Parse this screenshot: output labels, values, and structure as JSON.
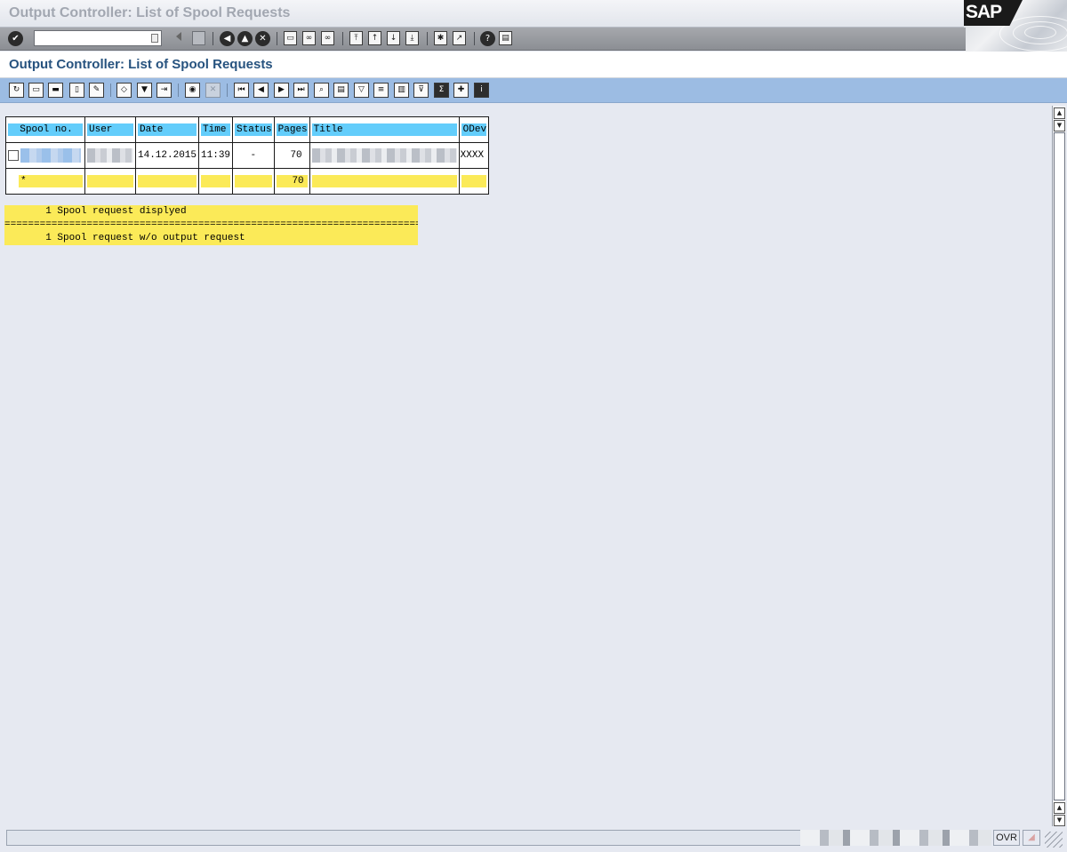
{
  "window": {
    "title": "Output Controller: List of Spool Requests",
    "logo": "SAP"
  },
  "system_toolbar": {
    "ok_code_value": "",
    "icons": [
      "enter-icon",
      "ok-code-dropdown-icon",
      "back-arrow-icon",
      "save-icon",
      "back-icon",
      "exit-icon",
      "cancel-icon",
      "print-icon",
      "find-icon",
      "find-next-icon",
      "first-page-icon",
      "previous-page-icon",
      "next-page-icon",
      "last-page-icon",
      "new-session-icon",
      "shortcut-icon",
      "help-icon",
      "layout-menu-icon"
    ]
  },
  "screen": {
    "title": "Output Controller: List of Spool Requests"
  },
  "app_toolbar": {
    "icons": [
      "refresh-icon",
      "display-contents-icon",
      "print-directly-icon",
      "delete-icon",
      "print-with-changed-attributes-icon",
      "output-requests-icon",
      "spool-attributes-icon",
      "forward-icon",
      "send-mail-icon",
      "archive-icon",
      "first-icon",
      "previous-icon",
      "next-icon",
      "last-icon",
      "search-icon",
      "print-preview-icon",
      "sort-ascending-icon",
      "sort-descending-icon",
      "filter-icon",
      "choose-layout-icon",
      "export-icon",
      "mark-icon",
      "info-icon"
    ]
  },
  "table": {
    "headers": [
      "Spool no.",
      "User",
      "Date",
      "Time",
      "Status",
      "Pages",
      "Title",
      "ODev"
    ],
    "rows": [
      {
        "spool_no": "",
        "user": "",
        "date": "14.12.2015",
        "time": "11:39",
        "status": "-",
        "pages": "70",
        "title": "",
        "odev": "XXXX"
      }
    ],
    "total_row": {
      "marker": "*",
      "pages": "70"
    }
  },
  "summary": {
    "line1": "       1 Spool request displyed",
    "line2": "========================================================================",
    "line3": "       1 Spool request w/o output request"
  },
  "statusbar": {
    "message": "",
    "mode": "OVR"
  }
}
